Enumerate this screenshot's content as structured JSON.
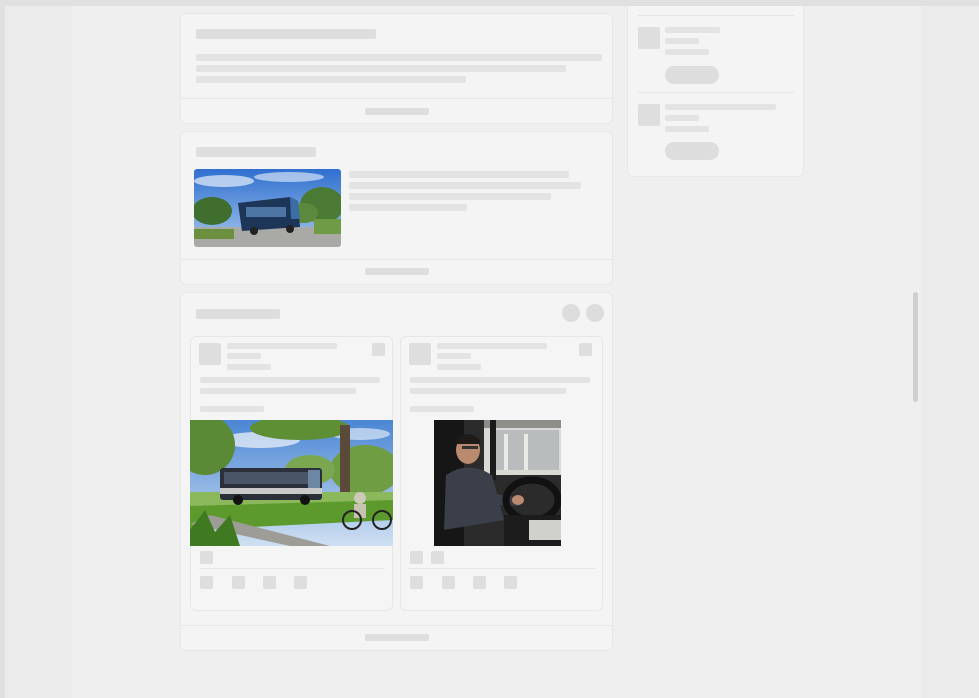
{
  "window": {
    "scrollbar": "vertical-scrollbar"
  },
  "feed": {
    "post1": {
      "kind": "text-post-skeleton"
    },
    "post2": {
      "kind": "link-post-skeleton",
      "image": "tour-coach-bus-photo"
    },
    "post3": {
      "kind": "carousel-post-skeleton",
      "slides": [
        {
          "image": "electric-city-bus-with-cyclist-photo"
        },
        {
          "image": "bus-driver-at-steering-wheel-photo"
        }
      ]
    }
  },
  "sidebar": {
    "items": [
      {
        "kind": "suggestion-skeleton"
      },
      {
        "kind": "suggestion-skeleton"
      }
    ]
  }
}
